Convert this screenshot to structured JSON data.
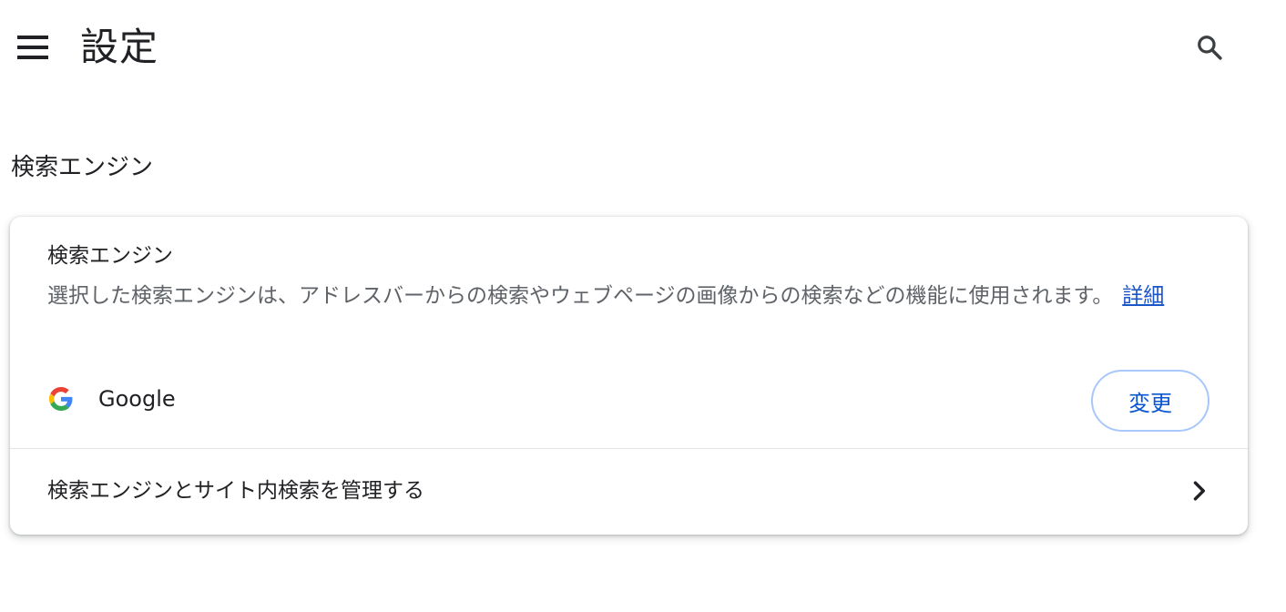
{
  "header": {
    "title": "設定",
    "menu_icon": "hamburger-menu-icon",
    "search_icon": "search-icon"
  },
  "section": {
    "title": "検索エンジン"
  },
  "card": {
    "title": "検索エンジン",
    "description": "選択した検索エンジンは、アドレスバーからの検索やウェブページの画像からの検索などの機能に使用されます。",
    "learn_more": "詳細",
    "engine": {
      "icon": "google-g-icon",
      "name": "Google"
    },
    "change_button": "変更",
    "manage_label": "検索エンジンとサイト内検索を管理する",
    "manage_icon": "chevron-right-icon"
  },
  "colors": {
    "accent": "#0b57d0",
    "link": "#1a55c9",
    "button_border": "#a8c7fa",
    "text_primary": "#202124",
    "text_secondary": "#5f6368"
  }
}
